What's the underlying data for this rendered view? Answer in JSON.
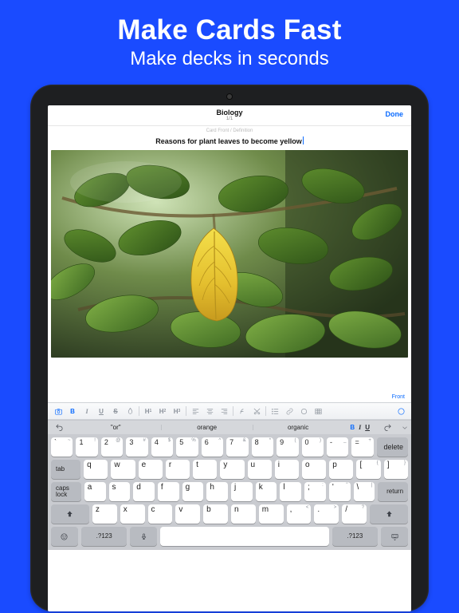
{
  "promo": {
    "title": "Make Cards Fast",
    "subtitle": "Make decks in seconds"
  },
  "nav": {
    "title": "Biology",
    "counter": "1/1",
    "hint": "Card Front / Definition",
    "done": "Done"
  },
  "card": {
    "text": "Reasons for plant leaves to become yellow",
    "side_label": "Front"
  },
  "toolbar": {
    "bold": "B",
    "italic": "I",
    "underline": "U",
    "strike": "S"
  },
  "suggestions": {
    "items": [
      "\"or\"",
      "orange",
      "organic"
    ],
    "b": "B",
    "i": "I",
    "u": "U"
  },
  "keyboard": {
    "row_num": [
      {
        "main": "`",
        "alt": "~"
      },
      {
        "main": "1",
        "alt": "!"
      },
      {
        "main": "2",
        "alt": "@"
      },
      {
        "main": "3",
        "alt": "#"
      },
      {
        "main": "4",
        "alt": "$"
      },
      {
        "main": "5",
        "alt": "%"
      },
      {
        "main": "6",
        "alt": "^"
      },
      {
        "main": "7",
        "alt": "&"
      },
      {
        "main": "8",
        "alt": "*"
      },
      {
        "main": "9",
        "alt": "("
      },
      {
        "main": "0",
        "alt": ")"
      },
      {
        "main": "-",
        "alt": "_"
      },
      {
        "main": "=",
        "alt": "+"
      }
    ],
    "row_q": [
      {
        "main": "q"
      },
      {
        "main": "w"
      },
      {
        "main": "e"
      },
      {
        "main": "r"
      },
      {
        "main": "t"
      },
      {
        "main": "y"
      },
      {
        "main": "u"
      },
      {
        "main": "i"
      },
      {
        "main": "o"
      },
      {
        "main": "p"
      },
      {
        "main": "[",
        "alt": "{"
      },
      {
        "main": "]",
        "alt": "}"
      }
    ],
    "row_a": [
      {
        "main": "a"
      },
      {
        "main": "s"
      },
      {
        "main": "d"
      },
      {
        "main": "f"
      },
      {
        "main": "g"
      },
      {
        "main": "h"
      },
      {
        "main": "j"
      },
      {
        "main": "k"
      },
      {
        "main": "l"
      },
      {
        "main": ";",
        "alt": ":"
      },
      {
        "main": "'",
        "alt": "\""
      },
      {
        "main": "\\",
        "alt": "|"
      }
    ],
    "row_z": [
      {
        "main": "z"
      },
      {
        "main": "x"
      },
      {
        "main": "c"
      },
      {
        "main": "v"
      },
      {
        "main": "b"
      },
      {
        "main": "n"
      },
      {
        "main": "m"
      },
      {
        "main": ",",
        "alt": "<"
      },
      {
        "main": ".",
        "alt": ">"
      },
      {
        "main": "/",
        "alt": "?"
      }
    ],
    "fn": {
      "delete": "delete",
      "tab": "tab",
      "caps": "caps lock",
      "return": "return",
      "shift": "shift",
      "numsym": ".?123"
    }
  }
}
